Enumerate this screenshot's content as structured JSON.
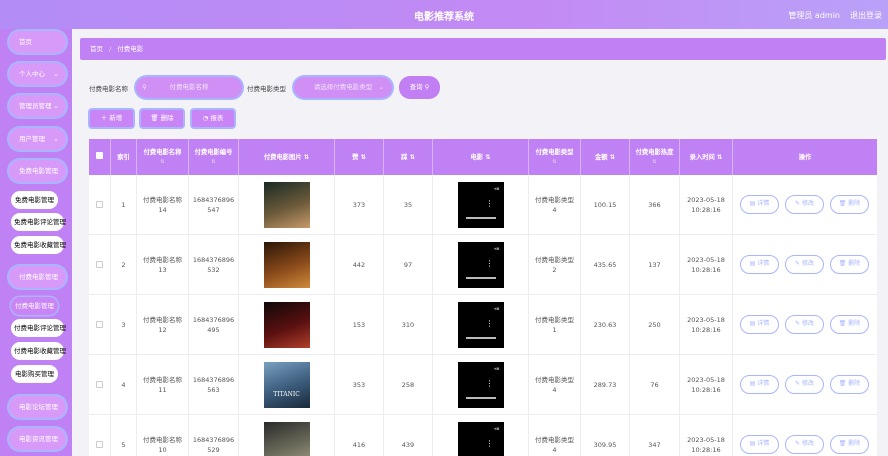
{
  "header": {
    "title": "电影推荐系统",
    "user": "管理员 admin",
    "logout": "退出登录"
  },
  "sidebar": {
    "items": [
      {
        "label": "首页",
        "chev": ""
      },
      {
        "label": "个人中心",
        "chev": "⌄"
      },
      {
        "label": "管理员管理",
        "chev": "⌄"
      },
      {
        "label": "用户管理",
        "chev": "⌄"
      },
      {
        "label": "免费电影管理",
        "chev": ""
      },
      {
        "label": "付费电影管理",
        "chev": ""
      },
      {
        "label": "电影论坛管理",
        "chev": ""
      },
      {
        "label": "电影资讯管理",
        "chev": ""
      }
    ],
    "free_sub": [
      "免费电影管理",
      "免费电影评论管理",
      "免费电影收藏管理"
    ],
    "paid_sub": [
      "付费电影管理",
      "付费电影评论管理",
      "付费电影收藏管理",
      "电影购买管理"
    ]
  },
  "breadcrumb": {
    "home": "首页",
    "sep": "/",
    "current": "付费电影"
  },
  "search": {
    "name_label": "付费电影名称",
    "name_placeholder": "付费电影名称",
    "type_label": "付费电影类型",
    "type_placeholder": "请选择付费电影类型",
    "query": "查询"
  },
  "actions": {
    "add": "新增",
    "delete": "删除",
    "report": "报表"
  },
  "table": {
    "headers": [
      "索引",
      "付费电影名称",
      "付费电影编号",
      "付费电影图片",
      "赞",
      "踩",
      "电影",
      "付费电影类型",
      "金额",
      "付费电影热度",
      "录入时间",
      "操作"
    ],
    "row_buttons": {
      "detail": "详情",
      "edit": "修改",
      "delete": "删除"
    },
    "rows": [
      {
        "index": "1",
        "name1": "付费电影名称",
        "name2": "14",
        "code1": "1684376896",
        "code2": "547",
        "likes": "373",
        "dislikes": "35",
        "type1": "付费电影类型",
        "type2": "4",
        "price": "100.15",
        "heat": "366",
        "date": "2023-05-18",
        "time": "10:28:16",
        "poster": [
          "#1a2a24",
          "#6b5a3a",
          "#c89a6a"
        ]
      },
      {
        "index": "2",
        "name1": "付费电影名称",
        "name2": "13",
        "code1": "1684376896",
        "code2": "532",
        "likes": "442",
        "dislikes": "97",
        "type1": "付费电影类型",
        "type2": "2",
        "price": "435.65",
        "heat": "137",
        "date": "2023-05-18",
        "time": "10:28:16",
        "poster": [
          "#2a1608",
          "#8a4a1a",
          "#d08a3a"
        ]
      },
      {
        "index": "3",
        "name1": "付费电影名称",
        "name2": "12",
        "code1": "1684376896",
        "code2": "495",
        "likes": "153",
        "dislikes": "310",
        "type1": "付费电影类型",
        "type2": "1",
        "price": "230.63",
        "heat": "250",
        "date": "2023-05-18",
        "time": "10:28:16",
        "poster": [
          "#100808",
          "#5a1010",
          "#b0402a"
        ]
      },
      {
        "index": "4",
        "name1": "付费电影名称",
        "name2": "11",
        "code1": "1684376896",
        "code2": "563",
        "likes": "353",
        "dislikes": "258",
        "type1": "付费电影类型",
        "type2": "4",
        "price": "289.73",
        "heat": "76",
        "date": "2023-05-18",
        "time": "10:28:16",
        "poster": [
          "#7aa0c0",
          "#3a5a7a",
          "#1a2a3a"
        ],
        "poster_text": "TITANIC"
      },
      {
        "index": "5",
        "name1": "付费电影名称",
        "name2": "10",
        "code1": "1684376896",
        "code2": "529",
        "likes": "416",
        "dislikes": "439",
        "type1": "付费电影类型",
        "type2": "4",
        "price": "309.95",
        "heat": "347",
        "date": "2023-05-18",
        "time": "10:28:16",
        "poster": [
          "#2a2a2a",
          "#6a6a5a",
          "#aaa08a"
        ]
      }
    ]
  },
  "icons": {
    "search": "search-icon",
    "plus": "plus-icon",
    "trash": "trash-icon",
    "report": "chart-icon",
    "chevron": "chevron-down-icon"
  },
  "colors": {
    "primary": "#c081f4",
    "accent_border": "#a9b6ff",
    "button_fill": "#c984f6"
  }
}
